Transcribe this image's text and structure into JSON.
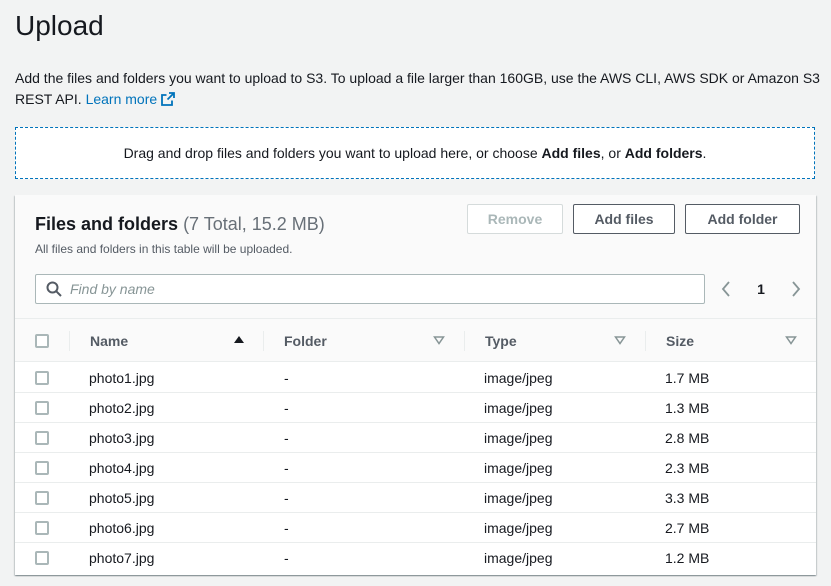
{
  "page": {
    "title": "Upload",
    "description": "Add the files and folders you want to upload to S3. To upload a file larger than 160GB, use the AWS CLI, AWS SDK or Amazon S3 REST API.",
    "learn_more": "Learn more"
  },
  "dropzone": {
    "text_before": "Drag and drop files and folders you want to upload here, or choose ",
    "add_files": "Add files",
    "text_middle": ", or ",
    "add_folders": "Add folders",
    "text_after": "."
  },
  "files_panel": {
    "title": "Files and folders",
    "count": "(7 Total, 15.2 MB)",
    "subtitle": "All files and folders in this table will be uploaded.",
    "buttons": {
      "remove": "Remove",
      "add_files": "Add files",
      "add_folder": "Add folder"
    },
    "search_placeholder": "Find by name",
    "current_page": "1"
  },
  "table": {
    "columns": [
      "Name",
      "Folder",
      "Type",
      "Size"
    ],
    "rows": [
      {
        "name": "photo1.jpg",
        "folder": "-",
        "type": "image/jpeg",
        "size": "1.7 MB"
      },
      {
        "name": "photo2.jpg",
        "folder": "-",
        "type": "image/jpeg",
        "size": "1.3 MB"
      },
      {
        "name": "photo3.jpg",
        "folder": "-",
        "type": "image/jpeg",
        "size": "2.8 MB"
      },
      {
        "name": "photo4.jpg",
        "folder": "-",
        "type": "image/jpeg",
        "size": "2.3 MB"
      },
      {
        "name": "photo5.jpg",
        "folder": "-",
        "type": "image/jpeg",
        "size": "3.3 MB"
      },
      {
        "name": "photo6.jpg",
        "folder": "-",
        "type": "image/jpeg",
        "size": "2.7 MB"
      },
      {
        "name": "photo7.jpg",
        "folder": "-",
        "type": "image/jpeg",
        "size": "1.2 MB"
      }
    ]
  },
  "colors": {
    "link": "#0073bb",
    "text": "#16191f",
    "border": "#eaeded",
    "background": "#f2f3f3"
  },
  "icons": [
    "external-link-icon",
    "search-icon",
    "chevron-left-icon",
    "chevron-right-icon",
    "sort-ascending-icon",
    "sort-descending-icon"
  ]
}
